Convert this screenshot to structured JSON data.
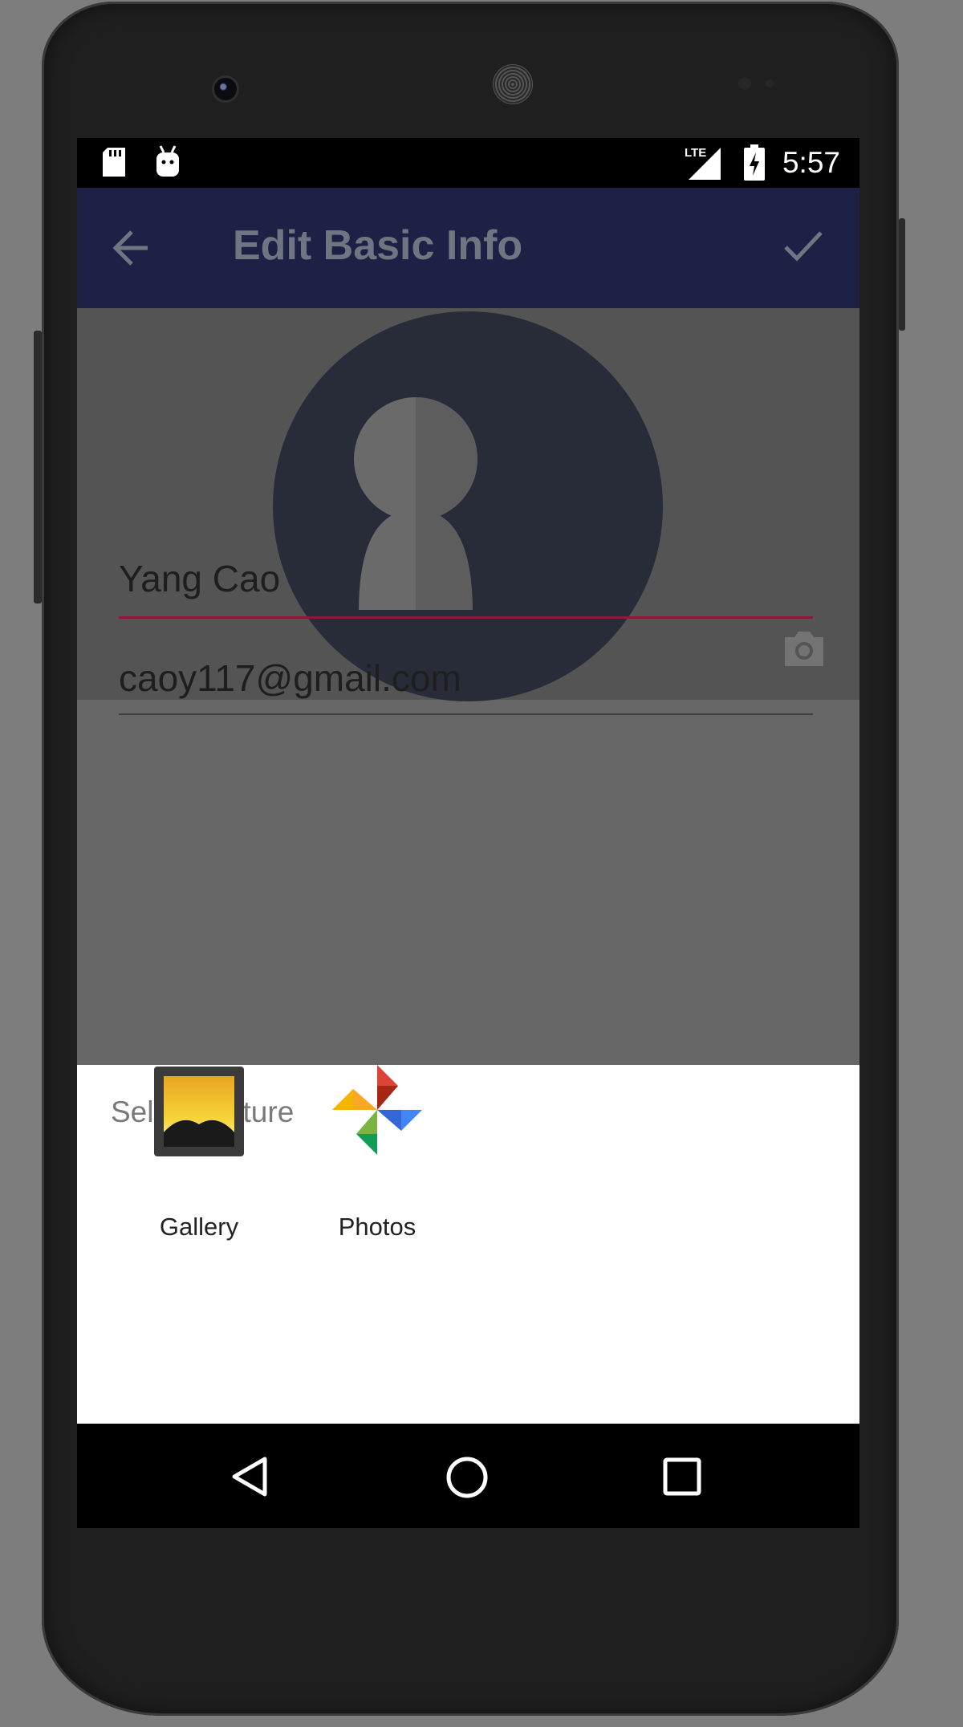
{
  "status_bar": {
    "time": "5:57",
    "network_label": "LTE",
    "icons": [
      "sd-card-icon",
      "android-debug-icon",
      "lte-signal-icon",
      "battery-charging-icon"
    ]
  },
  "app_bar": {
    "title": "Edit Basic Info",
    "back_icon": "arrow-left-icon",
    "confirm_icon": "checkmark-icon",
    "color": "#1c2145"
  },
  "profile": {
    "avatar_icon": "person-placeholder-icon",
    "camera_icon": "camera-icon"
  },
  "form": {
    "name_value": "Yang Cao",
    "email_value": "caoy117@gmail.com",
    "accent_color": "#8b1a3a"
  },
  "picker_sheet": {
    "title": "Select Picture",
    "apps": [
      {
        "label": "Gallery",
        "icon": "gallery-app-icon"
      },
      {
        "label": "Photos",
        "icon": "google-photos-icon"
      }
    ]
  },
  "nav_bar": {
    "buttons": [
      "back-triangle-icon",
      "home-circle-icon",
      "recents-square-icon"
    ]
  }
}
